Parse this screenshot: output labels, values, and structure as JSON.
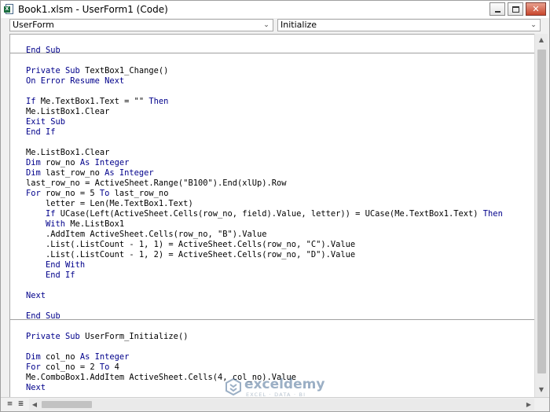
{
  "window": {
    "title": "Book1.xlsm - UserForm1 (Code)",
    "controls": {
      "minimize": "—",
      "maximize": "□",
      "close": "✕"
    }
  },
  "combos": {
    "object": {
      "value": "UserForm",
      "arrow": "chevron-down"
    },
    "procedure": {
      "value": "Initialize",
      "arrow": "chevron-down"
    }
  },
  "code_lines": [
    [
      {
        "t": "End Sub",
        "kw": true
      }
    ],
    [],
    [
      {
        "t": "Private Sub",
        "kw": true
      },
      {
        "t": " TextBox1_Change()"
      }
    ],
    [
      {
        "t": "On Error Resume Next",
        "kw": true
      }
    ],
    [],
    [
      {
        "t": "If",
        "kw": true
      },
      {
        "t": " Me.TextBox1.Text = \"\" "
      },
      {
        "t": "Then",
        "kw": true
      }
    ],
    [
      {
        "t": "Me.ListBox1.Clear"
      }
    ],
    [
      {
        "t": "Exit Sub",
        "kw": true
      }
    ],
    [
      {
        "t": "End If",
        "kw": true
      }
    ],
    [],
    [
      {
        "t": "Me.ListBox1.Clear"
      }
    ],
    [
      {
        "t": "Dim",
        "kw": true
      },
      {
        "t": " row_no "
      },
      {
        "t": "As Integer",
        "kw": true
      }
    ],
    [
      {
        "t": "Dim",
        "kw": true
      },
      {
        "t": " last_row_no "
      },
      {
        "t": "As Integer",
        "kw": true
      }
    ],
    [
      {
        "t": "last_row_no = ActiveSheet.Range(\"B100\").End(xlUp).Row"
      }
    ],
    [
      {
        "t": "For",
        "kw": true
      },
      {
        "t": " row_no = 5 "
      },
      {
        "t": "To",
        "kw": true
      },
      {
        "t": " last_row_no"
      }
    ],
    [
      {
        "t": "    letter = Len(Me.TextBox1.Text)"
      }
    ],
    [
      {
        "t": "    "
      },
      {
        "t": "If",
        "kw": true
      },
      {
        "t": " UCase(Left(ActiveSheet.Cells(row_no, field).Value, letter)) = UCase(Me.TextBox1.Text) "
      },
      {
        "t": "Then",
        "kw": true
      }
    ],
    [
      {
        "t": "    "
      },
      {
        "t": "With",
        "kw": true
      },
      {
        "t": " Me.ListBox1"
      }
    ],
    [
      {
        "t": "    .AddItem ActiveSheet.Cells(row_no, \"B\").Value"
      }
    ],
    [
      {
        "t": "    .List(.ListCount - 1, 1) = ActiveSheet.Cells(row_no, \"C\").Value"
      }
    ],
    [
      {
        "t": "    .List(.ListCount - 1, 2) = ActiveSheet.Cells(row_no, \"D\").Value"
      }
    ],
    [
      {
        "t": "    "
      },
      {
        "t": "End With",
        "kw": true
      }
    ],
    [
      {
        "t": "    "
      },
      {
        "t": "End If",
        "kw": true
      }
    ],
    [],
    [
      {
        "t": "Next",
        "kw": true
      }
    ],
    [],
    [
      {
        "t": "End Sub",
        "kw": true
      }
    ],
    [],
    [
      {
        "t": "Private Sub",
        "kw": true
      },
      {
        "t": " UserForm_Initialize()"
      }
    ],
    [],
    [
      {
        "t": "Dim",
        "kw": true
      },
      {
        "t": " col_no "
      },
      {
        "t": "As Integer",
        "kw": true
      }
    ],
    [
      {
        "t": "For",
        "kw": true
      },
      {
        "t": " col_no = 2 "
      },
      {
        "t": "To",
        "kw": true
      },
      {
        "t": " 4"
      }
    ],
    [
      {
        "t": "Me.ComboBox1.AddItem ActiveSheet.Cells(4, col_no).Value"
      }
    ],
    [
      {
        "t": "Next",
        "kw": true
      }
    ]
  ],
  "colors": {
    "keyword": "#00008b",
    "text": "#000000",
    "separator": "#a0a0a0"
  },
  "watermark": {
    "title": "exceldemy",
    "subtitle": "EXCEL · DATA · BI"
  },
  "icons": {
    "app": "excel-icon",
    "procedure_view": "procedure-view-icon",
    "module_view": "full-module-view-icon"
  }
}
